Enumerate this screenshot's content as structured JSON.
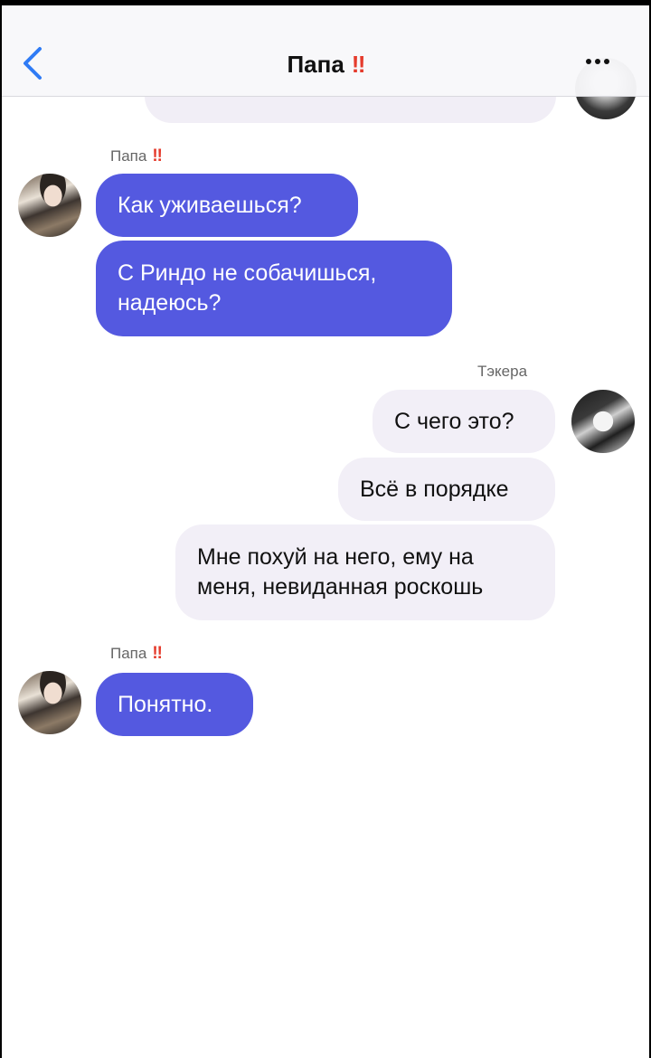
{
  "header": {
    "title": "Папа",
    "title_mark": "‼",
    "back_icon": "chevron-left-icon",
    "more_icon": "ellipsis-icon"
  },
  "colors": {
    "incoming_bubble": "#5459e0",
    "outgoing_bubble": "#f2eff7",
    "mark": "#e53b2c",
    "back_icon": "#2f7bf5"
  },
  "messages": {
    "group1": {
      "sender": "Папа",
      "mark": "‼",
      "m1": "Как уживаешься?",
      "m2": "С Риндо не собачишься, надеюсь?"
    },
    "group2": {
      "sender": "Тэкера",
      "m1": "С чего это?",
      "m2": "Всё в порядке",
      "m3": "Мне похуй на него, ему на меня, невиданная роскошь"
    },
    "group3": {
      "sender": "Папа",
      "mark": "‼",
      "m1": "Понятно."
    }
  }
}
